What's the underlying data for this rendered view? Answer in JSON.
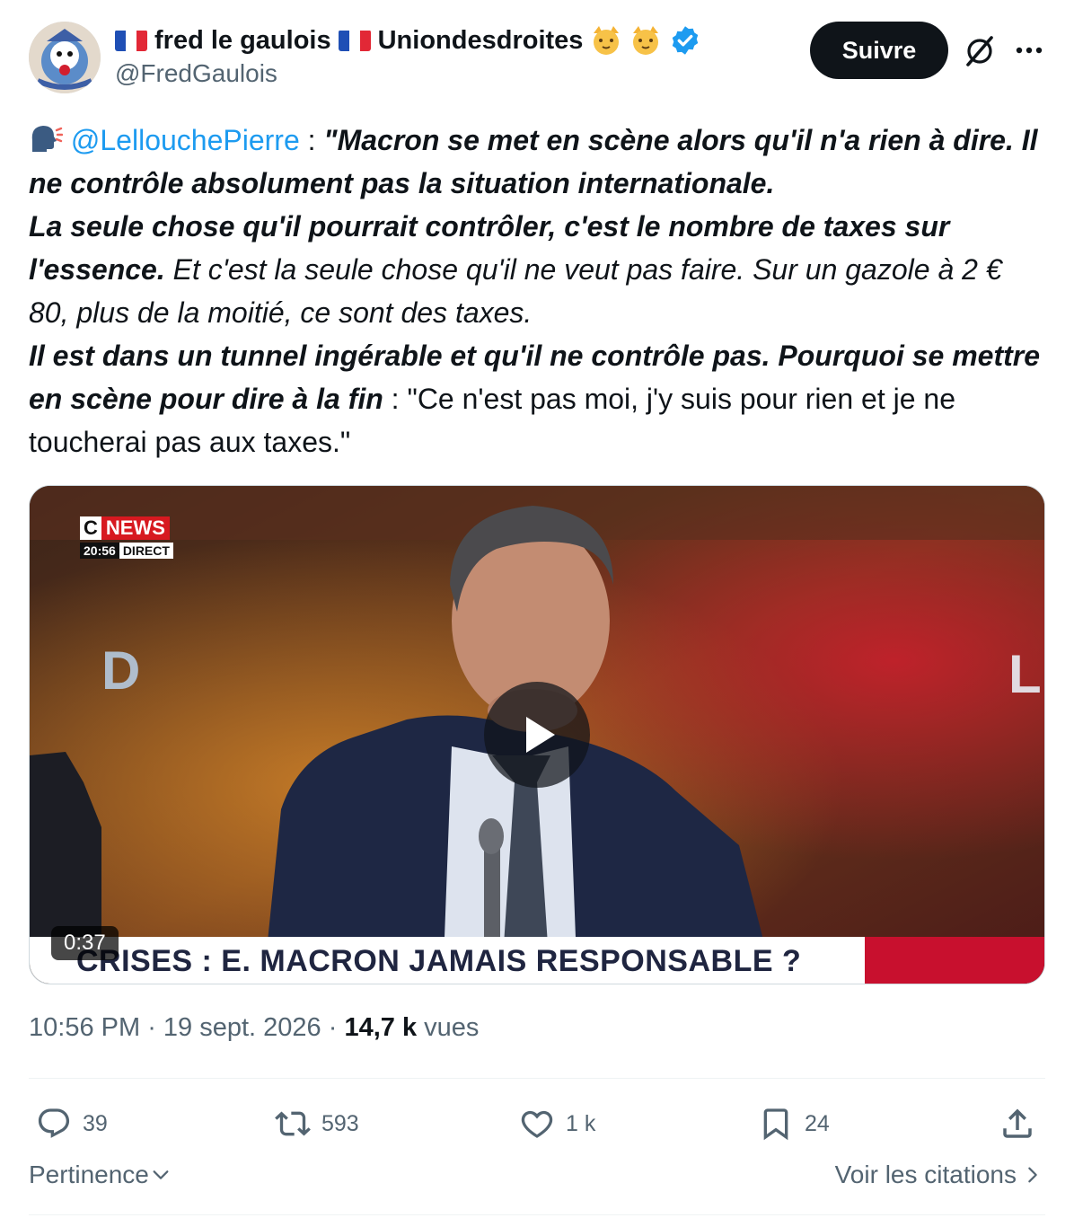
{
  "author": {
    "display_name_part1": "fred le gaulois",
    "display_name_part2": "Uniondesdroites",
    "handle": "@FredGaulois",
    "avatar_icon": "cartoon-avatar-icon",
    "verified_icon": "verified-badge-icon"
  },
  "header": {
    "follow_label": "Suivre",
    "grok_icon": "grok-icon",
    "more_icon": "more-icon"
  },
  "tweet": {
    "speaking_icon": "speaking-head-icon",
    "mention": "@LellouchePierre",
    "seg1_sep": " : ",
    "seg2_bold": "\"Macron se met en scène alors qu'il n'a rien à dire. Il ne contrôle absolument pas la situation internationale.",
    "seg3_bold": "La seule chose qu'il pourrait contrôler, c'est le nombre de taxes sur l'essence.",
    "seg4_italic": " Et c'est la seule chose qu'il ne veut pas faire. Sur un gazole à 2 € 80, plus de la moitié, ce sont des taxes.",
    "seg5_bold": "Il est dans un tunnel ingérable et qu'il ne contrôle pas. Pourquoi se mettre en scène pour dire à la fin",
    "seg6_plain": " : \"Ce n'est pas moi, j'y suis pour rien et je ne toucherai pas aux taxes.\""
  },
  "media": {
    "channel_c": "C",
    "channel_news": "NEWS",
    "live_time": "20:56",
    "live_label": "DIRECT",
    "banner_text": "CRISES : E. MACRON JAMAIS RESPONSABLE ?",
    "duration": "0:37",
    "play_icon": "play-icon",
    "accent_red": "#d71920"
  },
  "meta": {
    "time": "10:56 PM",
    "sep": " · ",
    "date": "19 sept. 2026",
    "views_count": "14,7 k",
    "views_label": " vues"
  },
  "actions": {
    "replies": "39",
    "reposts": "593",
    "likes": "1 k",
    "bookmarks": "24"
  },
  "footer": {
    "sort_label": "Pertinence",
    "quotes_label": "Voir les citations"
  },
  "colors": {
    "link": "#1d9bf0",
    "muted": "#536471",
    "text": "#0f1419",
    "verified": "#1d9bf0"
  }
}
